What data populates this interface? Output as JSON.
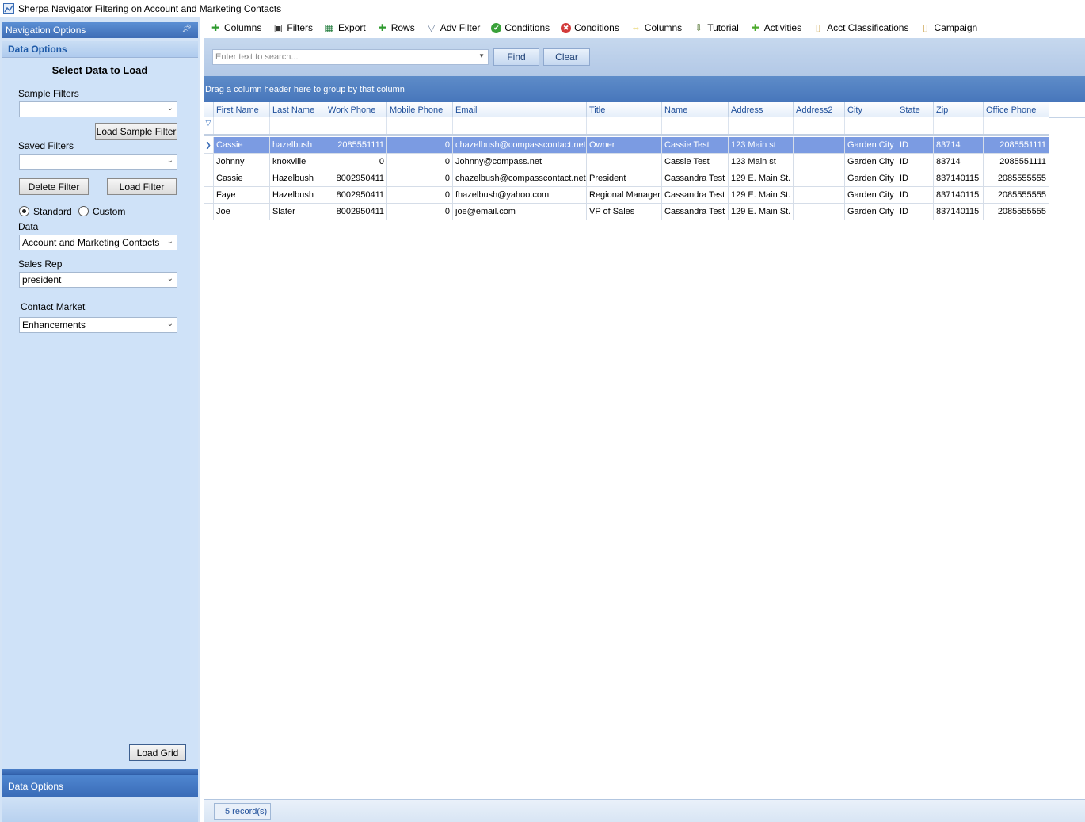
{
  "window": {
    "title": "Sherpa Navigator Filtering on Account and Marketing Contacts"
  },
  "left": {
    "nav_header": "Navigation Options",
    "section_title": "Data Options",
    "heading": "Select Data to Load",
    "sample_filters_label": "Sample Filters",
    "sample_filters_value": "",
    "load_sample_filter": "Load Sample Filter",
    "saved_filters_label": "Saved Filters",
    "saved_filters_value": "",
    "delete_filter": "Delete Filter",
    "load_filter": "Load Filter",
    "mode_standard": "Standard",
    "mode_custom": "Custom",
    "mode_selected": "Standard",
    "data_label": "Data",
    "data_value": "Account and Marketing Contacts",
    "sales_rep_label": "Sales Rep",
    "sales_rep_value": "president",
    "contact_market_label": "Contact Market",
    "contact_market_value": "Enhancements",
    "load_grid": "Load Grid",
    "bottom_tab": "Data Options"
  },
  "toolbar": [
    {
      "label": "Columns",
      "icon": "add-plus-icon",
      "color": "#2e9a2e"
    },
    {
      "label": "Filters",
      "icon": "save-disk-icon",
      "color": "#333333"
    },
    {
      "label": "Export",
      "icon": "excel-export-icon",
      "color": "#1e7a3a"
    },
    {
      "label": "Rows",
      "icon": "add-plus-icon",
      "color": "#2e9a2e"
    },
    {
      "label": "Adv Filter",
      "icon": "funnel-icon",
      "color": "#6b7d99"
    },
    {
      "label": "Conditions",
      "icon": "check-circle-icon",
      "color": "#3aa13a"
    },
    {
      "label": "Conditions",
      "icon": "remove-circle-icon",
      "color": "#d23a3a"
    },
    {
      "label": "Columns",
      "icon": "resize-arrows-icon",
      "color": "#d8b400"
    },
    {
      "label": "Tutorial",
      "icon": "down-arrow-icon",
      "color": "#5a7a3a"
    },
    {
      "label": "Activities",
      "icon": "green-cross-icon",
      "color": "#4caa2c"
    },
    {
      "label": "Acct Classifications",
      "icon": "clipboard-icon",
      "color": "#c9a04a"
    },
    {
      "label": "Campaign",
      "icon": "clipboard-icon",
      "color": "#c9a04a"
    }
  ],
  "search": {
    "placeholder": "Enter text to search...",
    "find": "Find",
    "clear": "Clear"
  },
  "group_panel_text": "Drag a column header here to group by that column",
  "grid": {
    "columns": [
      "First Name",
      "Last Name",
      "Work Phone",
      "Mobile Phone",
      "Email",
      "Title",
      "Name",
      "Address",
      "Address2",
      "City",
      "State",
      "Zip",
      "Office Phone"
    ],
    "rows": [
      [
        "Cassie",
        "hazelbush",
        "2085551111",
        "0",
        "chazelbush@compasscontact.net",
        "Owner",
        "Cassie Test",
        "123 Main st",
        "",
        "Garden City",
        "ID",
        "83714",
        "2085551111"
      ],
      [
        "Johnny",
        "knoxville",
        "0",
        "0",
        "Johnny@compass.net",
        "",
        "Cassie Test",
        "123 Main st",
        "",
        "Garden City",
        "ID",
        "83714",
        "2085551111"
      ],
      [
        "Cassie",
        "Hazelbush",
        "8002950411",
        "0",
        "chazelbush@compasscontact.net",
        "President",
        "Cassandra Test",
        "129 E. Main St.",
        "",
        "Garden City",
        "ID",
        "837140115",
        "2085555555"
      ],
      [
        "Faye",
        "Hazelbush",
        "8002950411",
        "0",
        "fhazelbush@yahoo.com",
        "Regional Manager",
        "Cassandra Test",
        "129 E. Main St.",
        "",
        "Garden City",
        "ID",
        "837140115",
        "2085555555"
      ],
      [
        "Joe",
        "Slater",
        "8002950411",
        "0",
        "joe@email.com",
        "VP of Sales",
        "Cassandra Test",
        "129 E. Main St.",
        "",
        "Garden City",
        "ID",
        "837140115",
        "2085555555"
      ]
    ],
    "selected_row": 0
  },
  "status": {
    "record_count": "5 record(s)"
  }
}
